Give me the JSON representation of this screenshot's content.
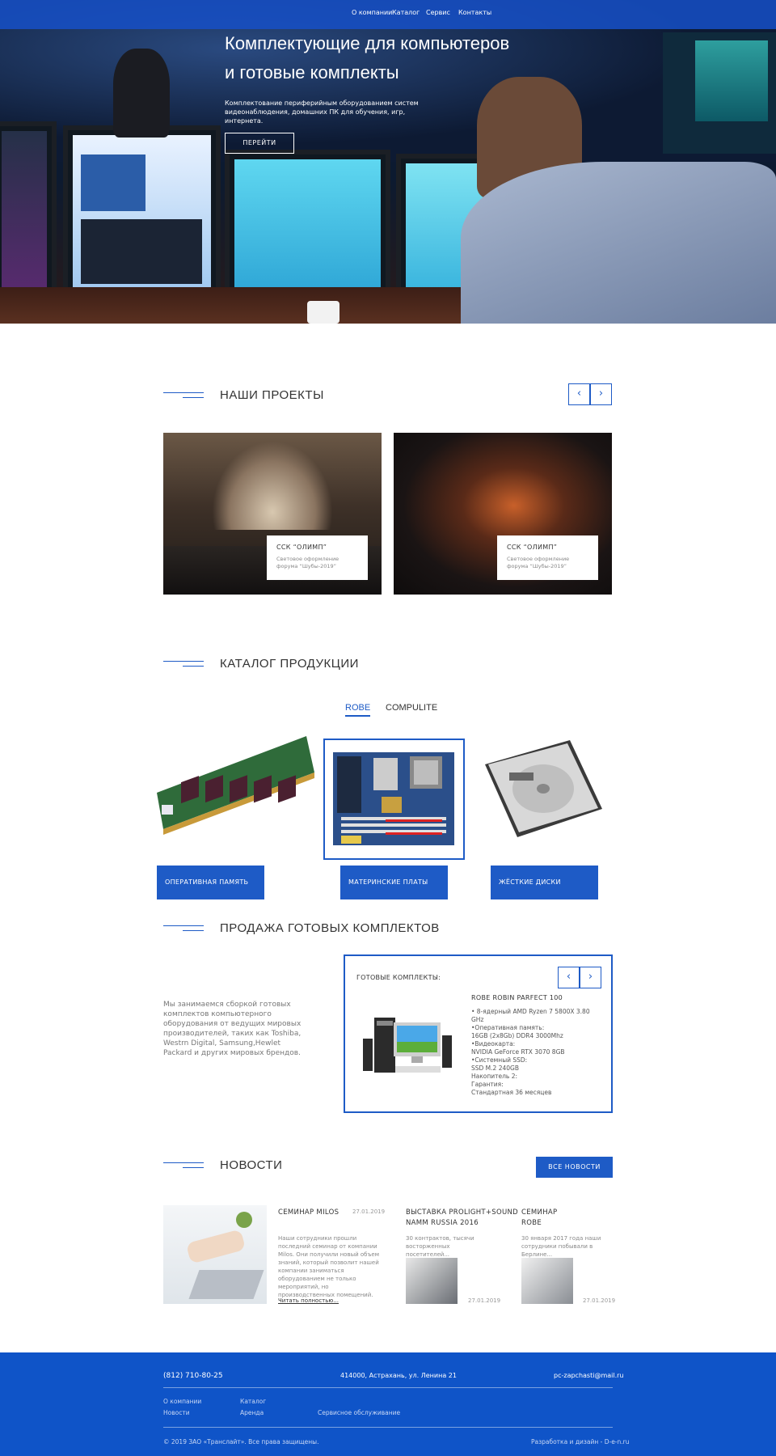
{
  "nav": {
    "items": [
      "О компании",
      "Каталог",
      "Сервис",
      "Контакты"
    ]
  },
  "hero": {
    "title_line1": "Комплектующие для компьютеров",
    "title_line2": "и готовые комплекты",
    "text": "Комплектование периферийным оборудованием систем видеонаблюдения, домашних ПК для обучения, игр, интернета.",
    "button": "ПЕРЕЙТИ"
  },
  "projects": {
    "title": "НАШИ ПРОЕКТЫ",
    "prev_icon": "‹",
    "next_icon": "›",
    "items": [
      {
        "title": "ССК “ОЛИМП”",
        "desc": "Световое оформление форума “Шубы-2019”"
      },
      {
        "title": "ССК “ОЛИМП”",
        "desc": "Световое оформление форума “Шубы-2019”"
      }
    ]
  },
  "catalog": {
    "title": "КАТАЛОГ ПРОДУКЦИИ",
    "tabs": [
      "ROBE",
      "COMPULITE"
    ],
    "active_tab": "ROBE",
    "items": [
      {
        "label": "ОПЕРАТИВНАЯ ПАМЯТЬ",
        "icon": "ram-module"
      },
      {
        "label": "МАТЕРИНСКИЕ ПЛАТЫ",
        "icon": "motherboard"
      },
      {
        "label": "ЖЁСТКИЕ ДИСКИ",
        "icon": "hard-drive"
      }
    ]
  },
  "kits": {
    "title": "ПРОДАЖА ГОТОВЫХ КОМПЛЕКТОВ",
    "text": "Мы занимаемся сборкой готовых комплектов компьютерного оборудования от ведущих мировых производителей, таких как Toshiba, Westrn Digital, Samsung,Hewlet Packard и других мировых брендов.",
    "box_label": "ГОТОВЫЕ КОМПЛЕКТЫ:",
    "product": "ROBE ROBIN PARFECT 100",
    "specs": [
      "• 8-ядерный AMD Ryzen 7 5800X 3.80",
      "   GHz",
      "•Оперативная память:",
      "  16GB (2x8Gb) DDR4 3000Mhz",
      "•Видеокарта:",
      "  NVIDIA GeForce RTX 3070 8GB",
      "•Системный SSD:",
      "  SSD M.2 240GB",
      "  Накопитель 2:",
      "  Гарантия:",
      "  Стандартная 36 месяцев"
    ]
  },
  "news": {
    "title": "НОВОСТИ",
    "all_button": "ВСЕ НОВОСТИ",
    "main": {
      "title": "СЕМИНАР MILOS",
      "date": "27.01.2019",
      "text": "Наши сотрудники прошли последний семинар от компании Milos. Они получили новый объем знаний, который позволит нашей компании заниматься оборудованием не только мероприятий, но производственных помещений.",
      "link": "Читать полностью..."
    },
    "items": [
      {
        "title_line1": "ВЫСТАВКА PROLIGHT+SOUND",
        "title_line2": "NAMM RUSSIA 2016",
        "text": "30 контрактов, тысячи восторженных посетителей...",
        "date": "27.01.2019"
      },
      {
        "title_line1": "СЕМИНАР",
        "title_line2": "ROBE",
        "text": "30 января 2017 года наши сотрудники побывали в Берлине...",
        "date": "27.01.2019"
      }
    ]
  },
  "footer": {
    "phone": "(812) 710-80-25",
    "address": "414000, Астрахань, ул. Ленина 21",
    "email": "pc-zapchasti@mail.ru",
    "links_col1": [
      "О компании",
      "Новости"
    ],
    "links_col2": [
      "Каталог",
      "Аренда"
    ],
    "links_col3": [
      "Сервисное обслуживание"
    ],
    "copyright": "© 2019 ЗАО «Транслайт». Все права защищены.",
    "dev": "Разработка и дизайн - D-e-n.ru"
  },
  "colors": {
    "accent": "#1e5bc6",
    "footer": "#0f54c8"
  }
}
